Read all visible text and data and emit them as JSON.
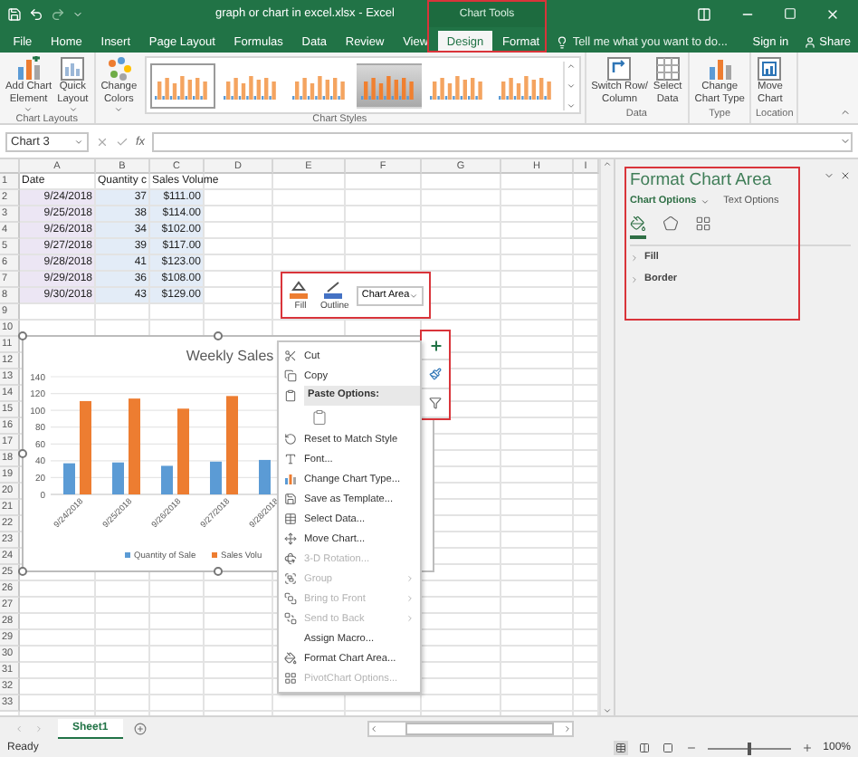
{
  "title_bar": {
    "title": "graph or chart in excel.xlsx - Excel",
    "context_label": "Chart Tools"
  },
  "ribbon_tabs": [
    {
      "label": "File",
      "selected": false
    },
    {
      "label": "Home",
      "selected": false
    },
    {
      "label": "Insert",
      "selected": false
    },
    {
      "label": "Page Layout",
      "selected": false
    },
    {
      "label": "Formulas",
      "selected": false
    },
    {
      "label": "Data",
      "selected": false
    },
    {
      "label": "Review",
      "selected": false
    },
    {
      "label": "View",
      "selected": false
    },
    {
      "label": "Design",
      "selected": true
    },
    {
      "label": "Format",
      "selected": false
    }
  ],
  "tell_me": {
    "placeholder": "Tell me what you want to do..."
  },
  "account": {
    "sign_in": "Sign in",
    "share": "Share"
  },
  "ribbon_groups": [
    {
      "label": "Chart Layouts",
      "buttons": [
        {
          "lines": [
            "Add Chart",
            "Element"
          ],
          "dropdown": true
        },
        {
          "lines": [
            "Quick",
            "Layout"
          ],
          "dropdown": true
        }
      ]
    },
    {
      "label": "Chart Styles",
      "buttons": [
        {
          "lines": [
            "Change",
            "Colors"
          ],
          "dropdown": true
        }
      ],
      "gallery": [
        {
          "selected": true,
          "kind": "plain"
        },
        {
          "selected": false,
          "kind": "plain"
        },
        {
          "selected": false,
          "kind": "plain"
        },
        {
          "selected": false,
          "kind": "shaded"
        },
        {
          "selected": false,
          "kind": "plain"
        },
        {
          "selected": false,
          "kind": "plain"
        }
      ]
    },
    {
      "label": "Data",
      "buttons": [
        {
          "lines": [
            "Switch Row/",
            "Column"
          ],
          "dropdown": false
        },
        {
          "lines": [
            "Select",
            "Data"
          ],
          "dropdown": false
        }
      ]
    },
    {
      "label": "Type",
      "buttons": [
        {
          "lines": [
            "Change",
            "Chart Type"
          ],
          "dropdown": false
        }
      ]
    },
    {
      "label": "Location",
      "buttons": [
        {
          "lines": [
            "Move",
            "Chart"
          ],
          "dropdown": false
        }
      ]
    }
  ],
  "formula_bar": {
    "name_box": "Chart 3",
    "function_label": "fx"
  },
  "sheet": {
    "columns": [
      {
        "label": "A",
        "kind": "category"
      },
      {
        "label": "B",
        "kind": "values"
      },
      {
        "label": "C",
        "kind": "values"
      },
      {
        "label": "D",
        "kind": "plain"
      },
      {
        "label": "E",
        "kind": "plain"
      },
      {
        "label": "F",
        "kind": "plain"
      },
      {
        "label": "G",
        "kind": "plain"
      },
      {
        "label": "H",
        "kind": "plain"
      },
      {
        "label": "I",
        "kind": "plain"
      }
    ],
    "row_numbers": [
      "1",
      "2",
      "3",
      "4",
      "5",
      "6",
      "7",
      "8",
      "9",
      "10",
      "11",
      "12",
      "13",
      "14",
      "15",
      "16",
      "17",
      "18",
      "19",
      "20",
      "21",
      "22",
      "23",
      "24",
      "25",
      "26",
      "27",
      "28",
      "29",
      "30",
      "31",
      "32",
      "33"
    ],
    "rows": [
      [
        "Date",
        "Quantity c",
        "Sales Volume"
      ],
      [
        "9/24/2018",
        "37",
        "$111.00"
      ],
      [
        "9/25/2018",
        "38",
        "$114.00"
      ],
      [
        "9/26/2018",
        "34",
        "$102.00"
      ],
      [
        "9/27/2018",
        "39",
        "$117.00"
      ],
      [
        "9/28/2018",
        "41",
        "$123.00"
      ],
      [
        "9/29/2018",
        "36",
        "$108.00"
      ],
      [
        "9/30/2018",
        "43",
        "$129.00"
      ]
    ]
  },
  "mini_toolbar": {
    "buttons": [
      {
        "label": "Fill"
      },
      {
        "label": "Outline"
      }
    ],
    "element_select": "Chart Area"
  },
  "chart": {
    "chart_data": {
      "type": "bar",
      "title": "Weekly Sales",
      "categories": [
        "9/24/2018",
        "9/25/2018",
        "9/26/2018",
        "9/27/2018",
        "9/28/2018"
      ],
      "series": [
        {
          "name": "Quantity of Sale",
          "color": "#5b9bd5",
          "values": [
            37,
            38,
            34,
            39,
            41
          ]
        },
        {
          "name": "Sales Volu",
          "color": "#ed7d31",
          "values": [
            111,
            114,
            102,
            117,
            null
          ]
        }
      ],
      "ylim": [
        0,
        140
      ],
      "yticks": [
        0,
        20,
        40,
        60,
        80,
        100,
        120,
        140
      ],
      "grid": true,
      "legend": true
    }
  },
  "context_menu": [
    {
      "kind": "command",
      "label": "Cut",
      "disabled": false,
      "submenu": false
    },
    {
      "kind": "command",
      "label": "Copy",
      "disabled": false,
      "submenu": false
    },
    {
      "kind": "header",
      "label": "Paste Options:"
    },
    {
      "kind": "paste"
    },
    {
      "kind": "command",
      "label": "Reset to Match Style",
      "disabled": false,
      "submenu": false
    },
    {
      "kind": "command",
      "label": "Font...",
      "disabled": false,
      "submenu": false
    },
    {
      "kind": "command",
      "label": "Change Chart Type...",
      "disabled": false,
      "submenu": false
    },
    {
      "kind": "command",
      "label": "Save as Template...",
      "disabled": false,
      "submenu": false
    },
    {
      "kind": "command",
      "label": "Select Data...",
      "disabled": false,
      "submenu": false
    },
    {
      "kind": "command",
      "label": "Move Chart...",
      "disabled": false,
      "submenu": false
    },
    {
      "kind": "command",
      "label": "3-D Rotation...",
      "disabled": true,
      "submenu": false
    },
    {
      "kind": "command",
      "label": "Group",
      "disabled": true,
      "submenu": true
    },
    {
      "kind": "command",
      "label": "Bring to Front",
      "disabled": true,
      "submenu": true
    },
    {
      "kind": "command",
      "label": "Send to Back",
      "disabled": true,
      "submenu": true
    },
    {
      "kind": "command",
      "label": "Assign Macro...",
      "disabled": false,
      "submenu": false
    },
    {
      "kind": "command",
      "label": "Format Chart Area...",
      "disabled": false,
      "submenu": false
    },
    {
      "kind": "command",
      "label": "PivotChart Options...",
      "disabled": true,
      "submenu": false
    }
  ],
  "task_pane": {
    "title": "Format Chart Area",
    "tabs": [
      {
        "label": "Chart Options",
        "selected": true
      },
      {
        "label": "Text Options",
        "selected": false
      }
    ],
    "icon_tabs": [
      {
        "selected": true
      },
      {
        "selected": false
      },
      {
        "selected": false
      }
    ],
    "sections": [
      {
        "label": "Fill",
        "expanded": false
      },
      {
        "label": "Border",
        "expanded": false
      }
    ]
  },
  "sheet_tabs": [
    {
      "label": "Sheet1",
      "selected": true
    }
  ],
  "status_bar": {
    "status": "Ready",
    "zoom": {
      "level": 0.5,
      "reading": "100%"
    }
  }
}
